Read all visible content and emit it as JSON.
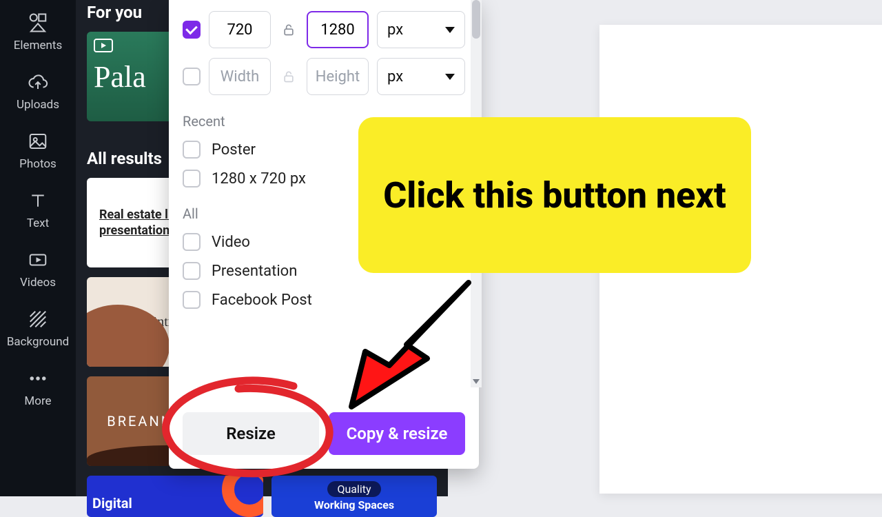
{
  "siderail": {
    "elements": "Elements",
    "uploads": "Uploads",
    "photos": "Photos",
    "text": "Text",
    "videos": "Videos",
    "background": "Background",
    "more": "More"
  },
  "results": {
    "for_you": "For you",
    "all_results": "All results",
    "palawan": "Pala",
    "realestate": "Real estate listing presentation",
    "mintmade": "Mintmade",
    "breanna": "BREANNA HOLL",
    "digital": "Digital",
    "quality": "Quality",
    "working_spaces": "Working Spaces"
  },
  "panel": {
    "width_value": "720",
    "height_value": "1280",
    "width_ph": "Width",
    "height_ph": "Height",
    "unit": "px",
    "recent_label": "Recent",
    "all_label": "All",
    "recent": {
      "poster": "Poster",
      "custom": "1280 x 720 px"
    },
    "all": {
      "video": "Video",
      "presentation": "Presentation",
      "facebook": "Facebook Post"
    },
    "resize_btn": "Resize",
    "copy_btn": "Copy & resize"
  },
  "annotation": {
    "text": "Click this button next"
  }
}
